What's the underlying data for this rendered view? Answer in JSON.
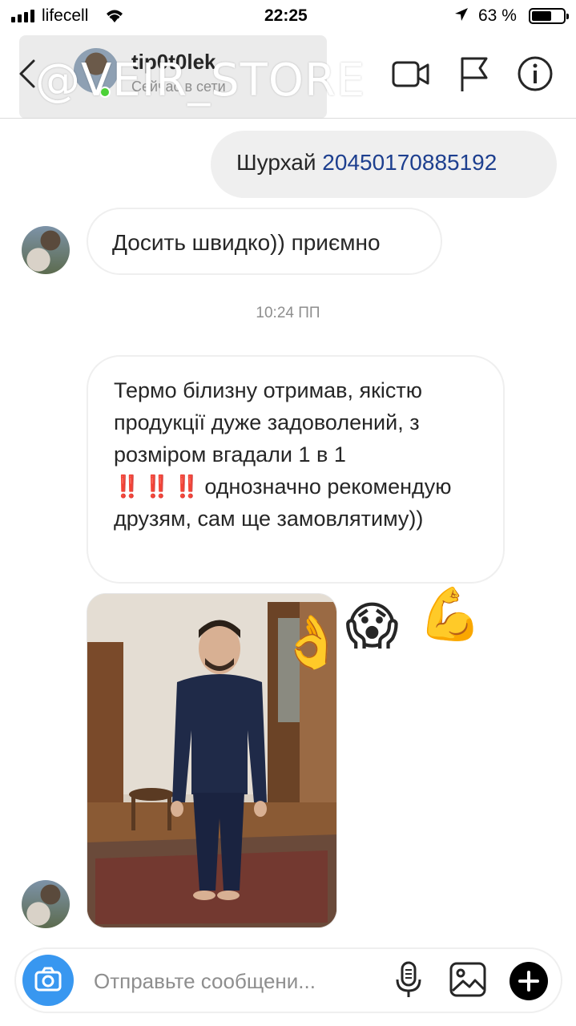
{
  "status_bar": {
    "carrier": "lifecell",
    "time": "22:25",
    "battery": "63 %",
    "battery_level": 0.63
  },
  "header": {
    "username": "tip0t0lek",
    "active_status": "Сейчас в сети",
    "watermark": "@VEIR_STORE",
    "icons": [
      "back-icon",
      "video-call-icon",
      "flag-icon",
      "info-icon"
    ]
  },
  "messages": {
    "outgoing_1": {
      "prefix": "Шурхай ",
      "number": "20450170885192"
    },
    "incoming_1": "Досить швидко)) приємно",
    "timestamp": "10:24 ПП",
    "incoming_2": {
      "line1": "Термо білизну отримав, якістю продукції дуже задоволений, з розміром вгадали 1 в 1",
      "bangs": "‼️ ‼️ ‼️",
      "line2": " однозначно рекомендую друзям, сам ще замовлятиму))"
    },
    "reactions": [
      "👌",
      "😱",
      "💪"
    ]
  },
  "composer": {
    "placeholder": "Отправьте сообщени..."
  }
}
